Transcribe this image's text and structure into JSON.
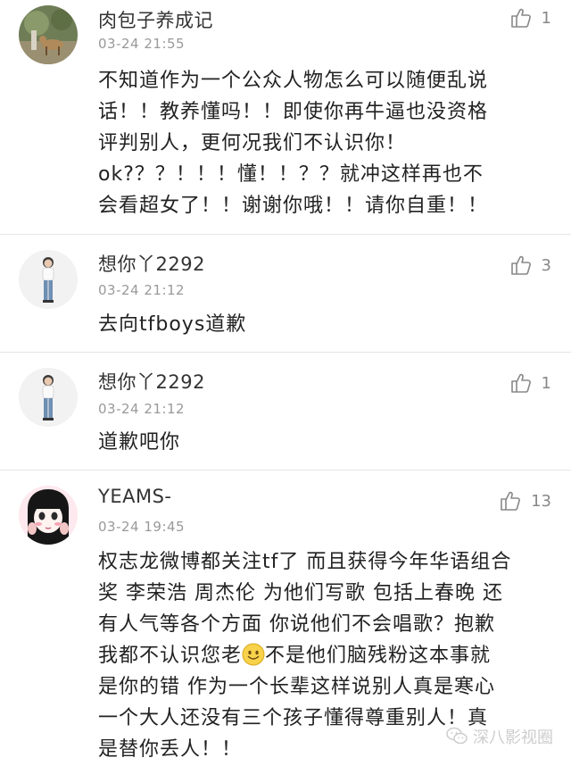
{
  "comments": [
    {
      "username": "肉包子养成记",
      "timestamp": "03-24 21:55",
      "likes": "1",
      "avatar": "deer-photo-avatar",
      "lines": [
        "不知道作为一个公众人物怎么可以随便乱说",
        "话！！教养懂吗！！即使你再牛逼也没资格",
        "评判别人，更何况我们不认识你！",
        "ok?？？！！！懂！！？？就冲这样再也不",
        "会看超女了！！谢谢你哦！！请你自重！！"
      ]
    },
    {
      "username": "想你丫2292",
      "timestamp": "03-24 21:12",
      "likes": "3",
      "avatar": "person-photo-avatar",
      "lines": [
        "去向tfboys道歉"
      ]
    },
    {
      "username": "想你丫2292",
      "timestamp": "03-24 21:12",
      "likes": "1",
      "avatar": "person-photo-avatar",
      "lines": [
        "道歉吧你"
      ]
    },
    {
      "username": "YEAMS-",
      "timestamp": "03-24 19:45",
      "likes": "13",
      "avatar": "anime-girl-avatar",
      "lines": [
        "权志龙微博都关注tf了 而且获得今年华语组合",
        "奖 李荣浩 周杰伦 为他们写歌 包括上春晚 还",
        "有人气等各个方面 你说他们不会唱歌？抱歉",
        "我都不认识您老",
        "是你的错 作为一个长辈这样说别人真是寒心",
        "一个大人还没有三个孩子懂得尊重别人！真",
        "是替你丢人！！"
      ],
      "line4_after_emoji": "不是他们脑残粉这本事就"
    }
  ],
  "watermark": "深八影视圈",
  "colors": {
    "username": "#333333",
    "timestamp": "#999999",
    "like_icon": "#888888",
    "divider": "#e6e6e6"
  },
  "icons": [
    "thumbs-up-icon",
    "smile-emoji-icon",
    "wechat-icon"
  ]
}
